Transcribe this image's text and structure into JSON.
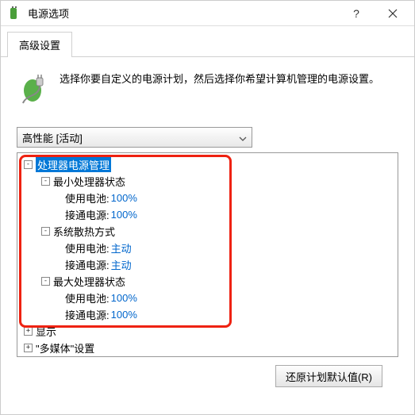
{
  "window": {
    "title": "电源选项"
  },
  "tab": {
    "label": "高级设置"
  },
  "description": "选择你要自定义的电源计划，然后选择你希望计算机管理的电源设置。",
  "combo": {
    "selected": "高性能 [活动]"
  },
  "tree": {
    "node0": {
      "label": "处理器电源管理"
    },
    "node0_0": {
      "label": "最小处理器状态"
    },
    "node0_0_battery": {
      "label": "使用电池:",
      "value": "100%"
    },
    "node0_0_ac": {
      "label": "接通电源:",
      "value": "100%"
    },
    "node0_1": {
      "label": "系统散热方式"
    },
    "node0_1_battery": {
      "label": "使用电池:",
      "value": "主动"
    },
    "node0_1_ac": {
      "label": "接通电源:",
      "value": "主动"
    },
    "node0_2": {
      "label": "最大处理器状态"
    },
    "node0_2_battery": {
      "label": "使用电池:",
      "value": "100%"
    },
    "node0_2_ac": {
      "label": "接通电源:",
      "value": "100%"
    },
    "node1": {
      "label": "显示"
    },
    "node2": {
      "label": "\"多媒体\"设置"
    }
  },
  "buttons": {
    "restore_defaults": "还原计划默认值(R)"
  }
}
